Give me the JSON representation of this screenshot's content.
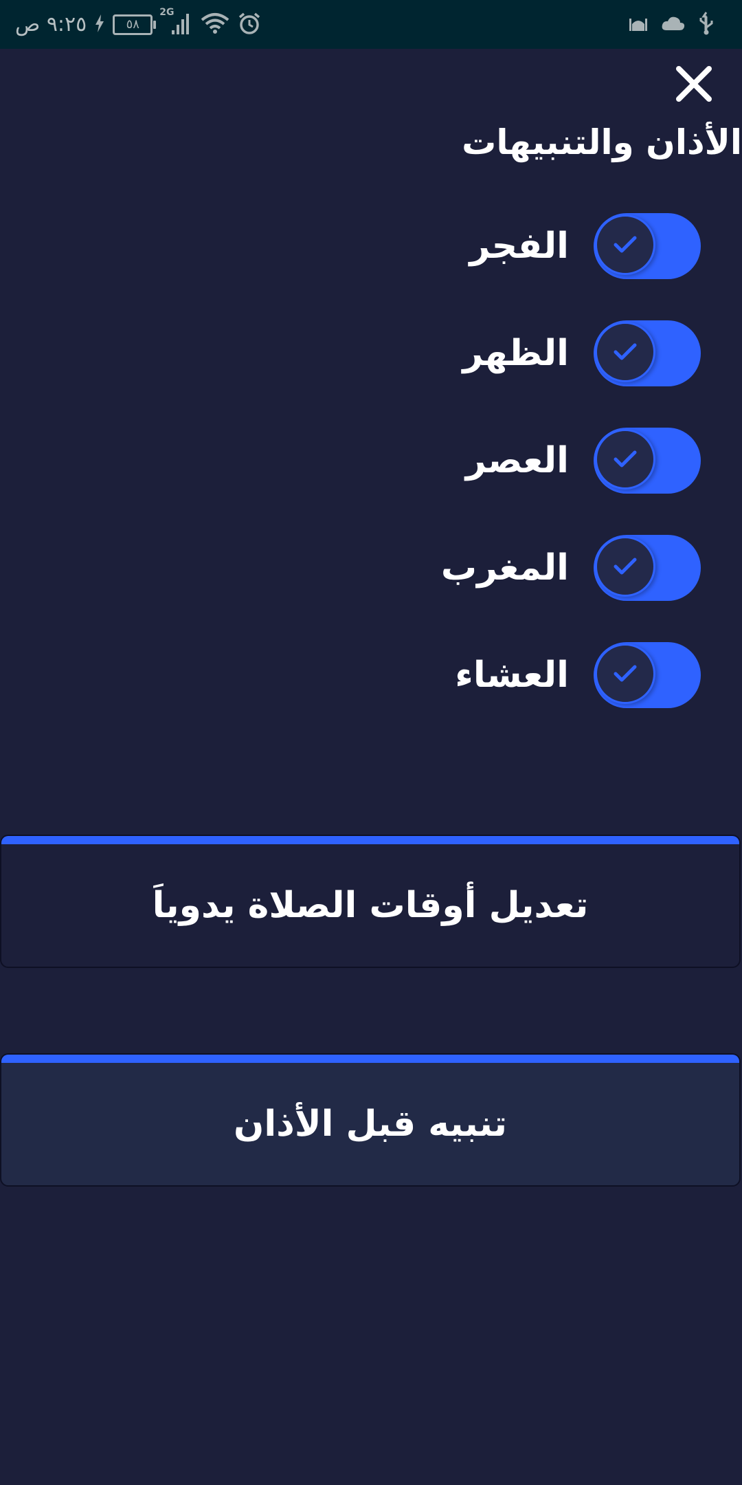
{
  "status_bar": {
    "time": "٩:٢٥ ص",
    "battery": "٥٨",
    "network": "2G"
  },
  "header": {
    "close_icon": "close-icon",
    "title": "الأذان والتنبيهات"
  },
  "prayers": [
    {
      "label": "الفجر",
      "enabled": true
    },
    {
      "label": "الظهر",
      "enabled": true
    },
    {
      "label": "العصر",
      "enabled": true
    },
    {
      "label": "المغرب",
      "enabled": true
    },
    {
      "label": "العشاء",
      "enabled": true
    }
  ],
  "actions": {
    "manual_adjust_label": "تعديل أوقات الصلاة يدوياَ",
    "pre_adhan_alert_label": "تنبيه قبل الأذان"
  },
  "colors": {
    "background": "#1c1f3a",
    "accent": "#2f62ff",
    "status_bar": "#002530"
  }
}
